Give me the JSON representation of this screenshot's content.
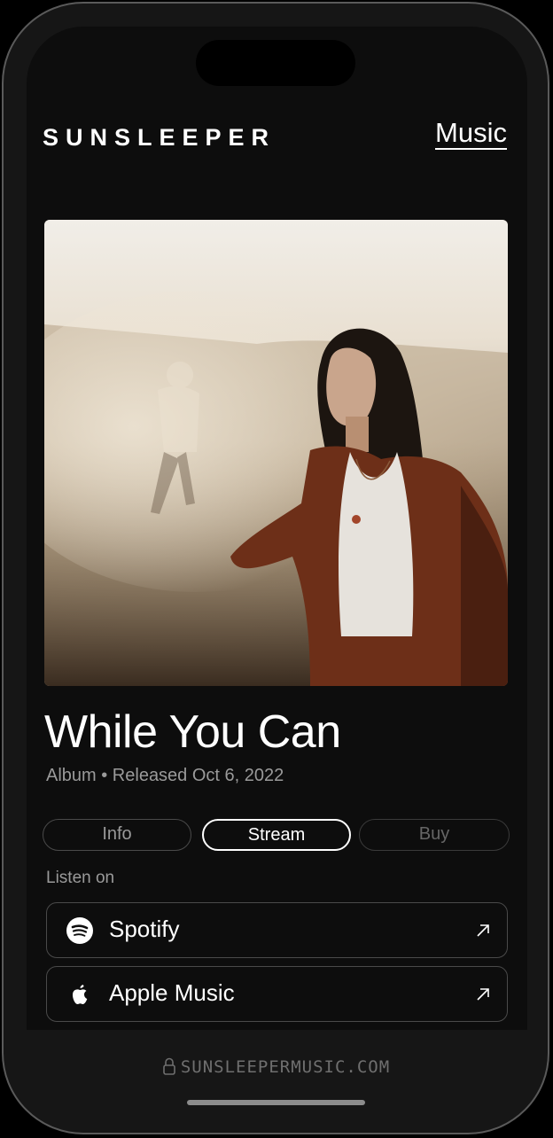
{
  "header": {
    "brand": "SUNSLEEPER",
    "nav_music": "Music"
  },
  "album": {
    "title": "While You Can",
    "meta": "Album • Released Oct 6, 2022"
  },
  "tabs": [
    {
      "label": "Info",
      "state": "inactive"
    },
    {
      "label": "Stream",
      "state": "active"
    },
    {
      "label": "Buy",
      "state": "disabled"
    }
  ],
  "listen": {
    "heading": "Listen on",
    "services": [
      {
        "name": "Spotify",
        "icon": "spotify-icon"
      },
      {
        "name": "Apple Music",
        "icon": "apple-icon"
      }
    ]
  },
  "browser": {
    "url": "SUNSLEEPERMUSIC.COM"
  },
  "colors": {
    "background": "#0d0d0d",
    "text": "#ffffff",
    "muted": "#9a9a9a",
    "border": "#4a4a4a"
  }
}
